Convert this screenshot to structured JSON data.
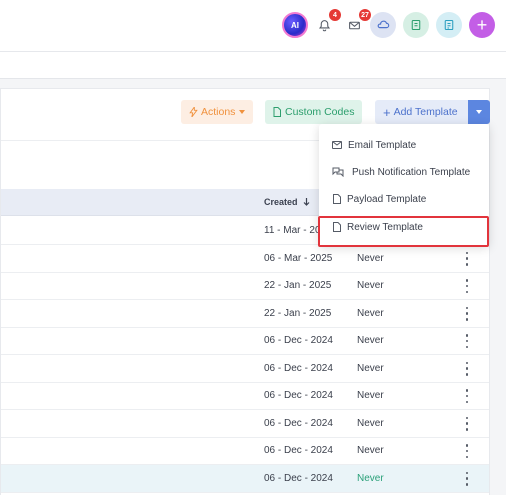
{
  "topbar": {
    "ai_label": "AI",
    "notifications_count": "4",
    "messages_count": "27",
    "plus_symbol": "+"
  },
  "toolbar": {
    "actions_label": "Actions",
    "custom_codes_label": "Custom Codes",
    "add_template_label": "Add Template"
  },
  "dropdown": {
    "items": [
      {
        "label": "Email Template",
        "icon": "mail-icon"
      },
      {
        "label": "Push Notification Template",
        "icon": "chat-icon"
      },
      {
        "label": "Payload Template",
        "icon": "file-icon"
      },
      {
        "label": "Review Template",
        "icon": "file-icon"
      }
    ],
    "highlighted_index": 3
  },
  "table": {
    "created_header": "Created",
    "rows": [
      {
        "date": "11 - Mar - 20",
        "never": ""
      },
      {
        "date": "06 - Mar - 2025",
        "never": "Never"
      },
      {
        "date": "22 - Jan - 2025",
        "never": "Never"
      },
      {
        "date": "22 - Jan - 2025",
        "never": "Never"
      },
      {
        "date": "06 - Dec - 2024",
        "never": "Never"
      },
      {
        "date": "06 - Dec - 2024",
        "never": "Never"
      },
      {
        "date": "06 - Dec - 2024",
        "never": "Never"
      },
      {
        "date": "06 - Dec - 2024",
        "never": "Never"
      },
      {
        "date": "06 - Dec - 2024",
        "never": "Never"
      },
      {
        "date": "06 - Dec - 2024",
        "never": "Never"
      }
    ]
  },
  "colors": {
    "accent": "#5c86e0",
    "actions": "#f0913d",
    "codes": "#2c9e6d",
    "highlight_row": "#eaf4f8",
    "outline": "#e2343c"
  }
}
